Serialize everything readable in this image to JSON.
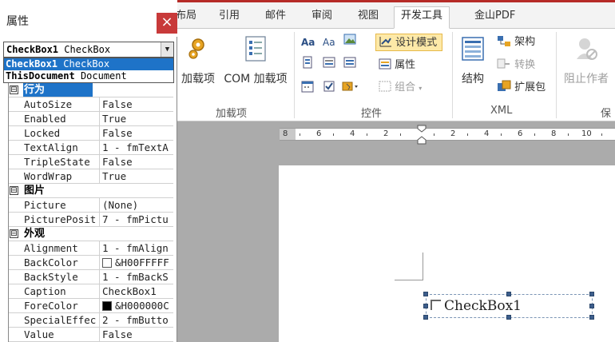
{
  "ribbon": {
    "tabs": [
      "布局",
      "引用",
      "邮件",
      "审阅",
      "视图",
      "开发工具",
      "金山PDF"
    ],
    "active_tab": "开发工具",
    "groups": {
      "addins": {
        "label": "加载项",
        "buttons": [
          "加载项",
          "COM 加载项"
        ]
      },
      "controls": {
        "label": "控件",
        "design_mode": "设计模式",
        "properties": "属性",
        "group": "组合"
      },
      "xml": {
        "label": "XML",
        "structure": "结构",
        "schema": "架构",
        "transform": "转换",
        "expansion": "扩展包"
      },
      "protect": {
        "label": "保",
        "block_authors": "阻止作者"
      }
    }
  },
  "ruler": {
    "labels": [
      "8",
      "6",
      "4",
      "2",
      "2",
      "4",
      "6",
      "8",
      "10"
    ]
  },
  "document": {
    "checkbox_caption": "CheckBox1"
  },
  "properties_window": {
    "title": "属性",
    "close_label": "×",
    "object_combo": {
      "name": "CheckBox1",
      "type": "CheckBox"
    },
    "object_list": [
      {
        "name": "CheckBox1",
        "type": "CheckBox",
        "selected": true
      },
      {
        "name": "ThisDocument",
        "type": "Document",
        "selected": false
      }
    ],
    "categories": [
      {
        "name": "行为",
        "expander": "⊟",
        "selected": true,
        "props": [
          {
            "name": "AutoSize",
            "value": "False"
          },
          {
            "name": "Enabled",
            "value": "True"
          },
          {
            "name": "Locked",
            "value": "False"
          },
          {
            "name": "TextAlign",
            "value": "1 - fmTextA"
          },
          {
            "name": "TripleState",
            "value": "False"
          },
          {
            "name": "WordWrap",
            "value": "True"
          }
        ]
      },
      {
        "name": "图片",
        "expander": "⊟",
        "selected": false,
        "props": [
          {
            "name": "Picture",
            "value": "(None)"
          },
          {
            "name": "PicturePosit",
            "value": "7 - fmPictu"
          }
        ]
      },
      {
        "name": "外观",
        "expander": "⊟",
        "selected": false,
        "props": [
          {
            "name": "Alignment",
            "value": "1 - fmAlign"
          },
          {
            "name": "BackColor",
            "value": "&H00FFFFF",
            "swatch": "#ffffff"
          },
          {
            "name": "BackStyle",
            "value": "1 - fmBackS"
          },
          {
            "name": "Caption",
            "value": "CheckBox1"
          },
          {
            "name": "ForeColor",
            "value": "&H000000C",
            "swatch": "#000000"
          },
          {
            "name": "SpecialEffec",
            "value": "2 - fmButto"
          },
          {
            "name": "Value",
            "value": "False"
          }
        ]
      }
    ]
  }
}
